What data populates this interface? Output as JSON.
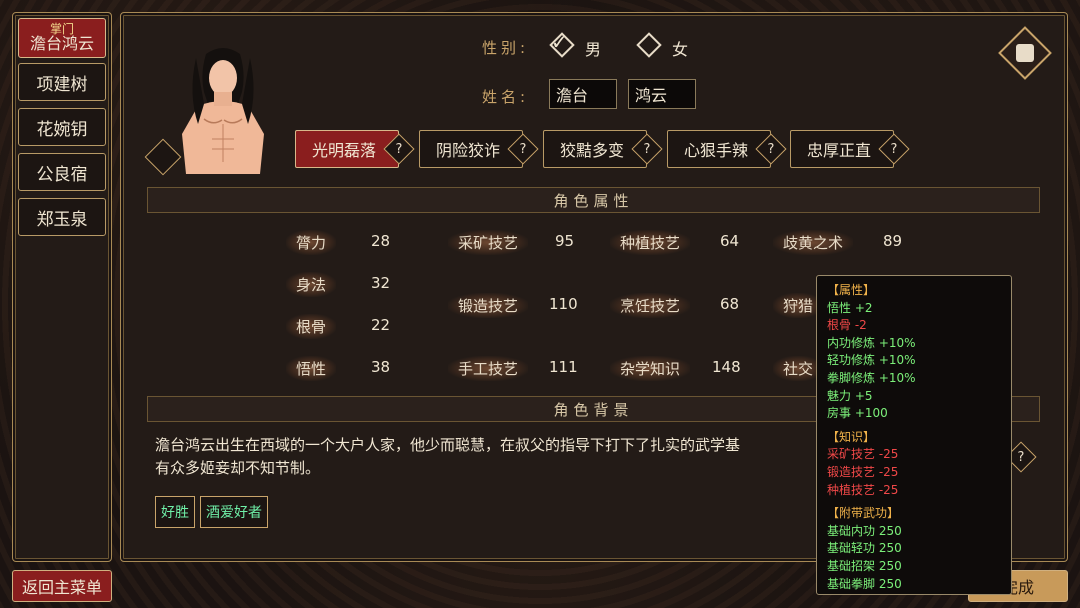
{
  "sidebar": {
    "active": {
      "sub": "掌门",
      "name": "澹台鸿云"
    },
    "items": [
      {
        "label": "项建树"
      },
      {
        "label": "花婉钥"
      },
      {
        "label": "公良宿"
      },
      {
        "label": "郑玉泉"
      }
    ]
  },
  "buttons": {
    "back": "返回主菜单",
    "done": "完成"
  },
  "gender": {
    "label": "性别:",
    "male": "男",
    "female": "女",
    "selected": "男"
  },
  "name": {
    "label": "姓名:",
    "surname": "澹台",
    "given": "鸿云"
  },
  "traits": [
    {
      "label": "光明磊落",
      "active": true
    },
    {
      "label": "阴险狡诈",
      "active": false
    },
    {
      "label": "狡黠多变",
      "active": false
    },
    {
      "label": "心狠手辣",
      "active": false
    },
    {
      "label": "忠厚正直",
      "active": false
    }
  ],
  "qmark": "?",
  "sections": {
    "attributes": "角色属性",
    "background": "角色背景"
  },
  "attributes": {
    "col1": [
      {
        "label": "膂力",
        "value": "28"
      },
      {
        "label": "身法",
        "value": "32"
      },
      {
        "label": "根骨",
        "value": "22"
      },
      {
        "label": "悟性",
        "value": "38"
      }
    ],
    "col2": [
      {
        "label": "采矿技艺",
        "value": "95"
      },
      {
        "label": "锻造技艺",
        "value": "110"
      },
      {
        "label": "手工技艺",
        "value": "111"
      }
    ],
    "col3": [
      {
        "label": "种植技艺",
        "value": "64"
      },
      {
        "label": "烹饪技艺",
        "value": "68"
      },
      {
        "label": "杂学知识",
        "value": "148"
      }
    ],
    "col4": [
      {
        "label": "歧黄之术",
        "value": "89"
      },
      {
        "label": "狩猎",
        "value": ""
      },
      {
        "label": "社交",
        "value": ""
      }
    ]
  },
  "bio": {
    "line1": "澹台鸿云出生在西域的一个大户人家，他少而聪慧，在叔父的指导下打下了扎实的武学基",
    "line2": "有众多姬妾却不知节制。"
  },
  "tags": [
    "好胜",
    "酒爱好者"
  ],
  "tooltip": {
    "attr_head": "【属性】",
    "attr": [
      {
        "name": "悟性",
        "val": "+2",
        "good": true
      },
      {
        "name": "根骨",
        "val": "-2",
        "good": false
      },
      {
        "name": "内功修炼",
        "val": "+10%",
        "good": true
      },
      {
        "name": "轻功修炼",
        "val": "+10%",
        "good": true
      },
      {
        "name": "拳脚修炼",
        "val": "+10%",
        "good": true
      },
      {
        "name": "魅力",
        "val": "+5",
        "good": true
      },
      {
        "name": "房事",
        "val": "+100",
        "good": true
      }
    ],
    "know_head": "【知识】",
    "know": [
      {
        "name": "采矿技艺",
        "val": "-25"
      },
      {
        "name": "锻造技艺",
        "val": "-25"
      },
      {
        "name": "种植技艺",
        "val": "-25"
      }
    ],
    "martial_head": "【附带武功】",
    "martial": [
      {
        "name": "基础内功",
        "val": "250"
      },
      {
        "name": "基础轻功",
        "val": "250"
      },
      {
        "name": "基础招架",
        "val": "250"
      },
      {
        "name": "基础拳脚",
        "val": "250"
      }
    ]
  },
  "colors": {
    "accent_red": "#8a1e1e",
    "gold": "#c9a46a",
    "good": "#7cf07a",
    "bad": "#f04848",
    "tag_text": "#6ff0a8"
  }
}
